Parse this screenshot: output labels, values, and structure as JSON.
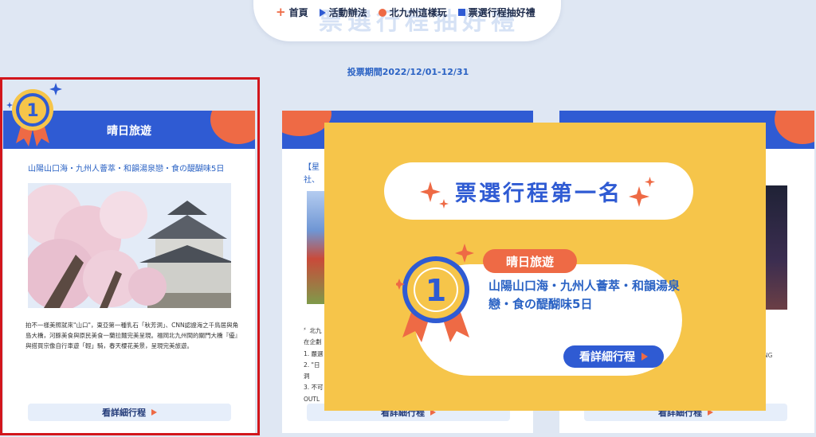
{
  "nav": {
    "ghost_title": "票選行程抽好禮",
    "items": [
      {
        "label": "首頁",
        "icon": "plus-icon"
      },
      {
        "label": "活動辦法",
        "icon": "triangle-icon"
      },
      {
        "label": "北九州這樣玩",
        "icon": "dot-icon"
      },
      {
        "label": "票選行程抽好禮",
        "icon": "square-icon"
      }
    ]
  },
  "vote_period": "投票期間2022/12/01-12/31",
  "colors": {
    "blue": "#2f5bd3",
    "orange": "#ee6a45",
    "yellow": "#f6c54a",
    "text_blue": "#2a62c4",
    "highlight": "#d2161c"
  },
  "card1": {
    "rank": "1",
    "title": "晴日旅遊",
    "subtitle": "山陽山口海・九州人薈萃・和韻湯泉戀・食の醍醐味5日",
    "description": "拍不一樣美照就來\"山口\"，東亞第一種乳石「秋芳洞」、CNN認證海之千鳥居與角島大橋，河豚美食與原民美食一蘭拉麵完美呈現。福岡北九州間的關門大橋『優』與搭買宗像自行車遊「輕」騎，春天櫻花美景，呈現完美旅遊。",
    "button": "看詳細行程"
  },
  "card2": {
    "subtitle_frag_1": "【星",
    "subtitle_frag_2": "社、",
    "list": [
      "〞北九",
      "在企劃",
      "1. 嚴選",
      "2. \"日",
      "洞",
      "3. 不可",
      "OUTL"
    ],
    "button": "看詳細行程"
  },
  "card3": {
    "desc_frag": "NG",
    "button": "看詳細行程"
  },
  "popup": {
    "title": "票選行程第一名",
    "rank": "1",
    "tag": "晴日旅遊",
    "description": "山陽山口海・九州人薈萃・和韻湯泉戀・食の醍醐味5日",
    "button": "看詳細行程"
  }
}
